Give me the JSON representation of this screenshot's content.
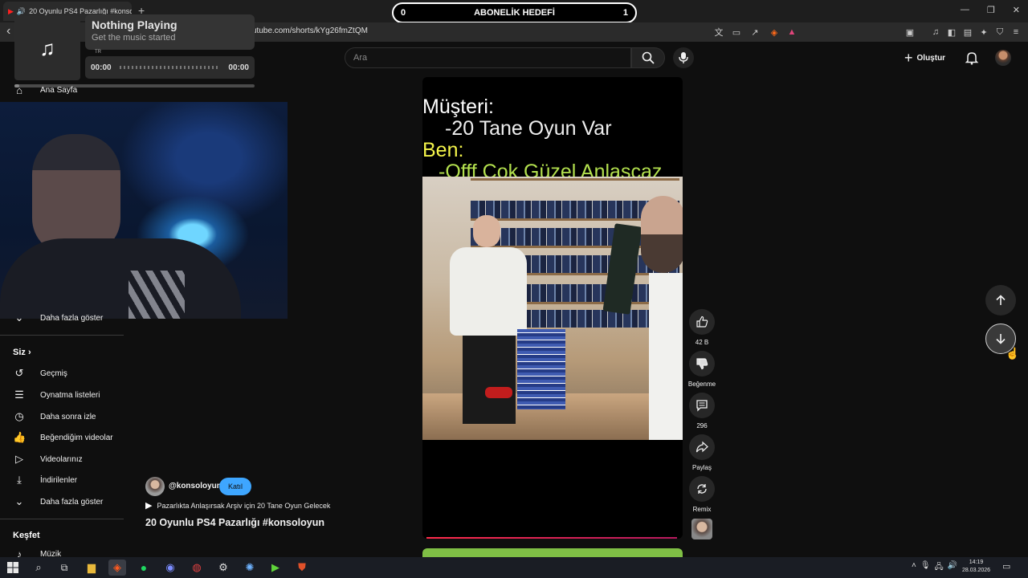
{
  "browser": {
    "tab_title": "20 Oyunlu PS4 Pazarlığı #konsoloyun",
    "tab_close": "×",
    "new_tab": "+",
    "url": "utube.com/shorts/kYg26fmZtQM"
  },
  "stream_overlay": {
    "sub_goal_left": "0",
    "sub_goal_label": "ABONELİK HEDEFİ",
    "sub_goal_right": "1"
  },
  "music_widget": {
    "title": "Nothing Playing",
    "subtitle": "Get the music started",
    "region": "TR",
    "time_start": "00:00",
    "time_end": "00:00"
  },
  "sidebar": {
    "home_label": "Ana Sayfa",
    "show_more_top": "Daha fazla göster",
    "you_heading": "Siz",
    "items": [
      {
        "label": "Geçmiş",
        "icon": "history-icon"
      },
      {
        "label": "Oynatma listeleri",
        "icon": "playlist-icon"
      },
      {
        "label": "Daha sonra izle",
        "icon": "clock-icon"
      },
      {
        "label": "Beğendiğim videolar",
        "icon": "thumbs-up-icon"
      },
      {
        "label": "Videolarınız",
        "icon": "video-icon"
      },
      {
        "label": "İndirilenler",
        "icon": "download-icon"
      },
      {
        "label": "Daha fazla göster",
        "icon": "chevron-down-icon"
      }
    ],
    "explore_heading": "Keşfet",
    "explore_items": [
      {
        "label": "Müzik",
        "icon": "music-icon"
      }
    ]
  },
  "header": {
    "search_placeholder": "Ara",
    "create_label": "Oluştur"
  },
  "short": {
    "caption_lines": [
      "Müşteri:",
      "-20 Tane Oyun Var",
      "Ben:",
      "-Offf Çok Güzel Anlaşcaz"
    ],
    "channel": "@konsoloyun",
    "join_label": "Katıl",
    "song": "Pazarlıkta Anlaşırsak Arşiv için 20 Tane Oyun Gelecek",
    "title": "20 Oyunlu PS4 Pazarlığı  #konsoloyun",
    "actions": {
      "like_count": "42 B",
      "dislike_label": "Beğenme",
      "comment_count": "296",
      "share_label": "Paylaş",
      "remix_label": "Remix"
    }
  },
  "taskbar": {
    "clock_time": "14:19",
    "clock_date": "28.03.2026"
  },
  "colors": {
    "accent_blue": "#3ea6ff",
    "progress_red": "#ff2b4a",
    "caption_yellow": "#f3f34a",
    "caption_green": "#b3e04e"
  }
}
